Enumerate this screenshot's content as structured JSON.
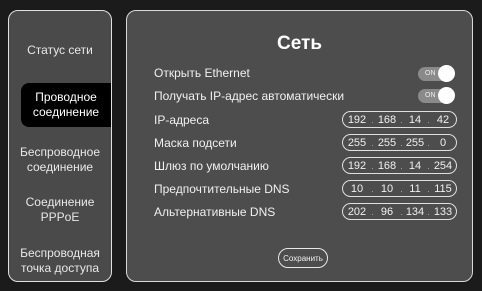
{
  "sidebar": {
    "items": [
      {
        "label": "Статус сети"
      },
      {
        "label": "Проводное соединение"
      },
      {
        "label": "Беспроводное соединение"
      },
      {
        "label": "Соединение PPPoE"
      },
      {
        "label": "Беспроводная точка доступа"
      }
    ],
    "active_index": 1
  },
  "main": {
    "title": "Сеть",
    "open_ethernet": {
      "label": "Открыть Ethernet",
      "toggle": "ON"
    },
    "auto_ip": {
      "label": "Получать IP-адрес автоматически",
      "toggle": "ON"
    },
    "fields": [
      {
        "label": "IP-адреса",
        "octets": [
          "192",
          "168",
          "14",
          "42"
        ]
      },
      {
        "label": "Маска подсети",
        "octets": [
          "255",
          "255",
          "255",
          "0"
        ]
      },
      {
        "label": "Шлюз по умолчанию",
        "octets": [
          "192",
          "168",
          "14",
          "254"
        ]
      },
      {
        "label": "Предпочтительные DNS",
        "octets": [
          "10",
          "10",
          "11",
          "115"
        ]
      },
      {
        "label": "Альтернативные DNS",
        "octets": [
          "202",
          "96",
          "134",
          "133"
        ]
      }
    ],
    "save_label": "Сохранить"
  }
}
